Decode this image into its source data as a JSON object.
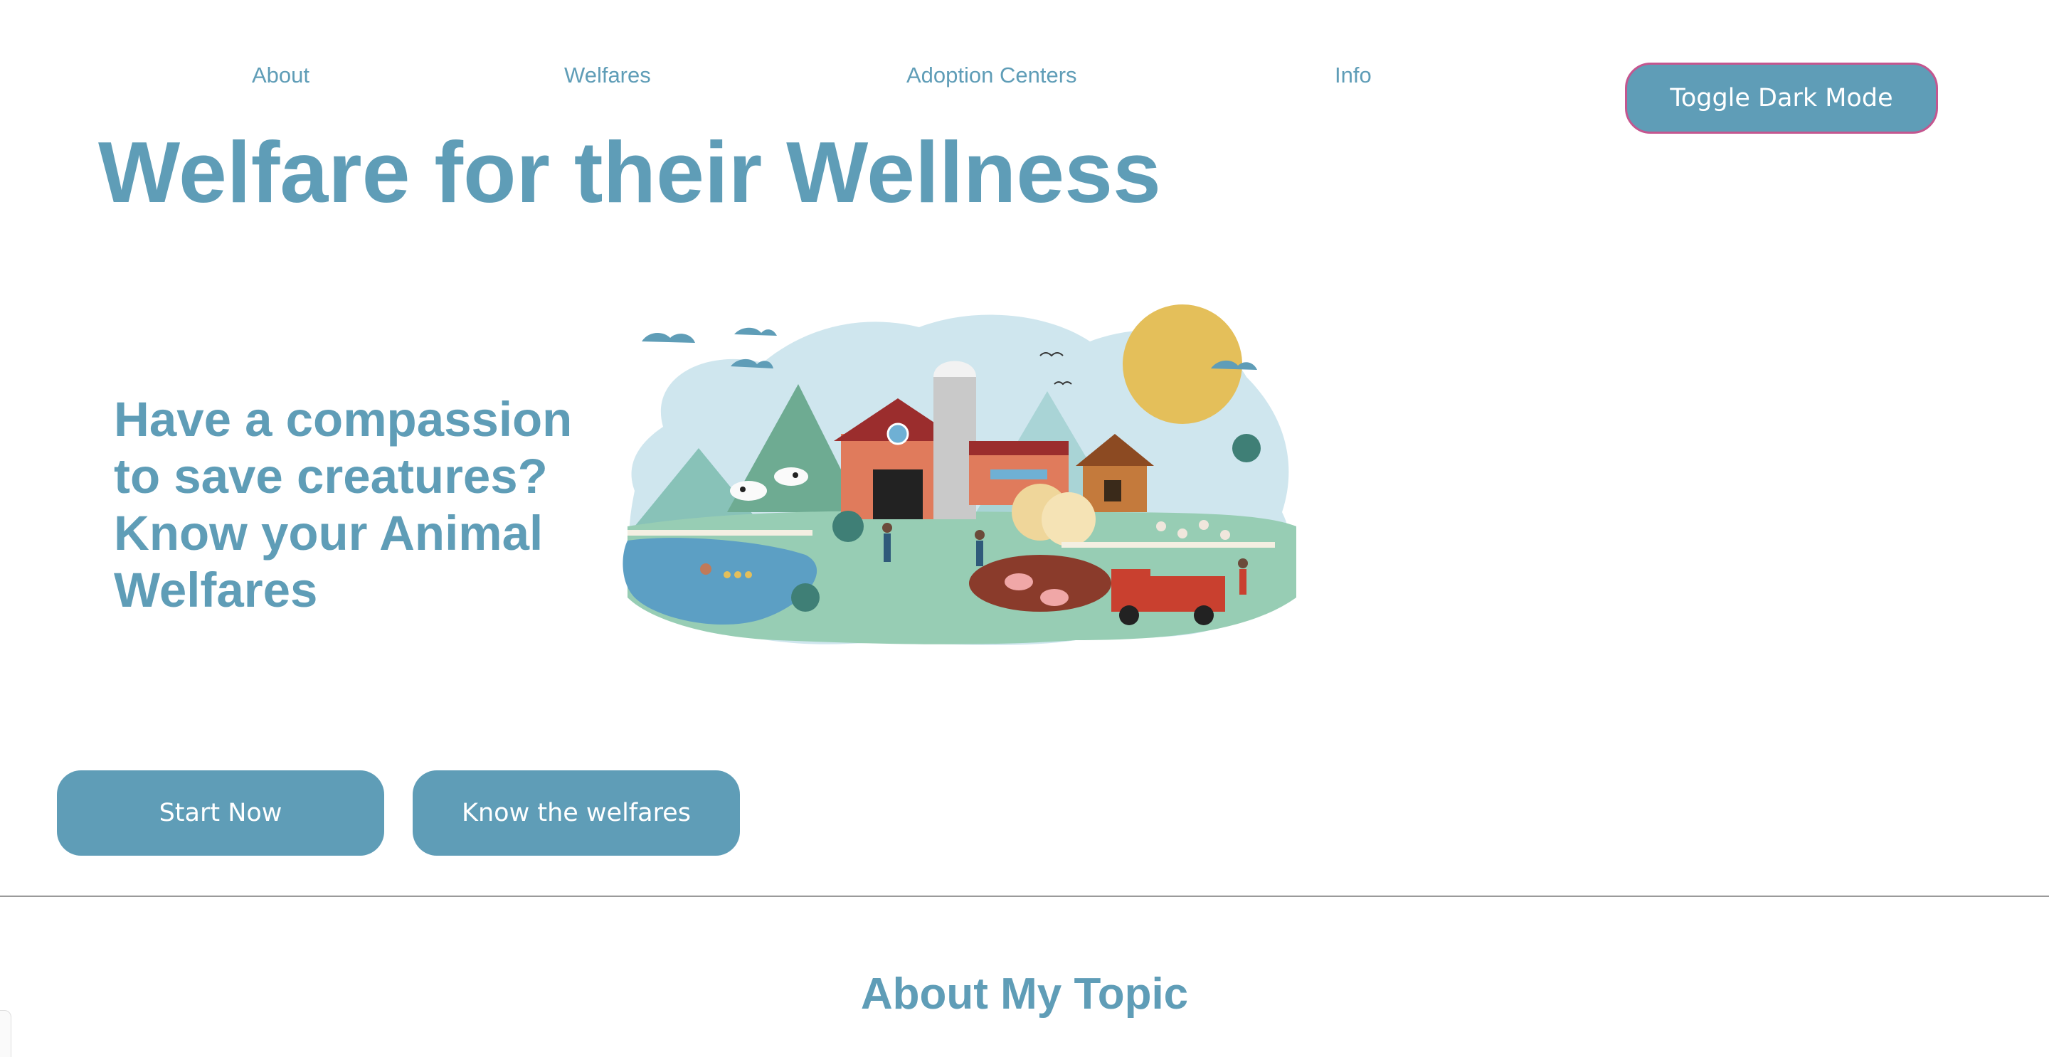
{
  "nav": {
    "items": [
      {
        "label": "About"
      },
      {
        "label": "Welfares"
      },
      {
        "label": "Adoption Centers"
      },
      {
        "label": "Info"
      }
    ],
    "toggle_label": "Toggle Dark Mode"
  },
  "hero": {
    "title": "Welfare for their Wellness",
    "tagline": "Have a compassion to save creatures? Know your Animal Welfares",
    "image_alt": "farm illustration"
  },
  "buttons": {
    "start_label": "Start Now",
    "welfares_label": "Know the welfares"
  },
  "about": {
    "title": "About My Topic"
  },
  "colors": {
    "accent": "#5f9db7",
    "toggle_border": "#c4568f",
    "background": "#ffffff"
  }
}
